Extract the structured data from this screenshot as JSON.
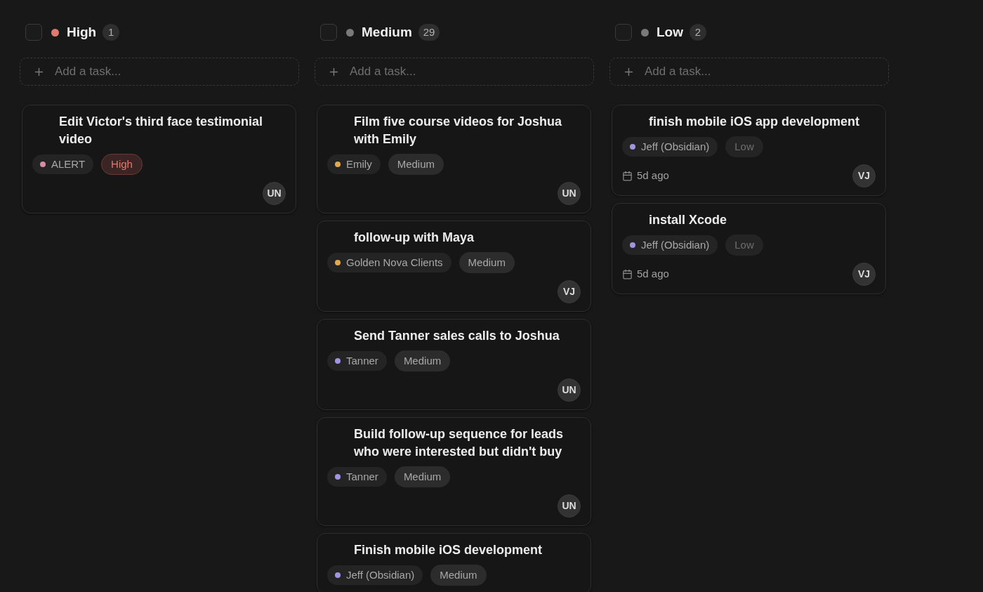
{
  "columns": [
    {
      "title": "High",
      "color": "#e07a70",
      "count": "1",
      "checked": false,
      "add_placeholder": "Add a task...",
      "tasks": [
        {
          "title": "Edit Victor's third face testimonial video",
          "label": {
            "text": "ALERT",
            "color": "#d98aa8"
          },
          "priority": {
            "text": "High",
            "kind": "high"
          },
          "avatar": "UN"
        }
      ]
    },
    {
      "title": "Medium",
      "color": "#7a7a7a",
      "count": "29",
      "checked": false,
      "add_placeholder": "Add a task...",
      "tasks": [
        {
          "title": "Film five course videos for Joshua with Emily",
          "label": {
            "text": "Emily",
            "color": "#e0a94f"
          },
          "priority": {
            "text": "Medium",
            "kind": "medium"
          },
          "avatar": "UN"
        },
        {
          "title": "follow-up with Maya",
          "label": {
            "text": "Golden Nova Clients",
            "color": "#e0a94f"
          },
          "priority": {
            "text": "Medium",
            "kind": "medium"
          },
          "avatar": "VJ"
        },
        {
          "title": "Send Tanner sales calls to Joshua",
          "label": {
            "text": "Tanner",
            "color": "#a194e0"
          },
          "priority": {
            "text": "Medium",
            "kind": "medium"
          },
          "avatar": "UN"
        },
        {
          "title": "Build follow-up sequence for leads who were interested but didn't buy",
          "label": {
            "text": "Tanner",
            "color": "#a194e0"
          },
          "priority": {
            "text": "Medium",
            "kind": "medium"
          },
          "avatar": "UN"
        },
        {
          "title": "Finish mobile iOS development",
          "label": {
            "text": "Jeff (Obsidian)",
            "color": "#a194e0"
          },
          "priority": {
            "text": "Medium",
            "kind": "medium"
          }
        }
      ]
    },
    {
      "title": "Low",
      "color": "#7a7a7a",
      "count": "2",
      "checked": false,
      "add_placeholder": "Add a task...",
      "tasks": [
        {
          "title": "finish mobile iOS app development",
          "label": {
            "text": "Jeff (Obsidian)",
            "color": "#a194e0"
          },
          "priority": {
            "text": "Low",
            "kind": "low"
          },
          "date": "5d ago",
          "avatar": "VJ"
        },
        {
          "title": "install Xcode",
          "label": {
            "text": "Jeff (Obsidian)",
            "color": "#a194e0"
          },
          "priority": {
            "text": "Low",
            "kind": "low"
          },
          "date": "5d ago",
          "avatar": "VJ"
        }
      ]
    }
  ]
}
